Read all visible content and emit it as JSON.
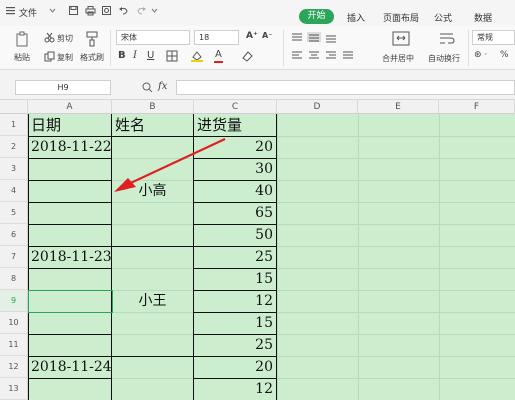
{
  "menubar": {
    "file": "文件",
    "tabs": [
      "开始",
      "插入",
      "页面布局",
      "公式",
      "数据"
    ]
  },
  "ribbon": {
    "paste": "粘贴",
    "cut": "剪切",
    "copy": "复制",
    "format_painter": "格式刷",
    "font_name": "宋体",
    "font_size": "18",
    "merge_center": "合并居中",
    "auto_wrap": "自动换行",
    "number_format": "常规"
  },
  "formula_bar": {
    "name_box": "H9",
    "fx": "fx",
    "content": ""
  },
  "columns": [
    "A",
    "B",
    "C",
    "D",
    "E",
    "F"
  ],
  "rows": [
    "1",
    "2",
    "3",
    "4",
    "5",
    "6",
    "7",
    "8",
    "9",
    "10",
    "11",
    "12",
    "13"
  ],
  "selected_row": "9",
  "table": {
    "headers": [
      "日期",
      "姓名",
      "进货量"
    ],
    "dates": [
      "2018-11-22",
      "2018-11-23",
      "2018-11-24"
    ],
    "names": [
      "小高",
      "小王"
    ],
    "quantities": [
      "20",
      "30",
      "40",
      "65",
      "50",
      "25",
      "15",
      "12",
      "15",
      "25",
      "20",
      "12"
    ]
  },
  "colors": {
    "accent": "#2aa55a",
    "sheet_fill": "#cceecf",
    "arrow": "#e02020"
  }
}
